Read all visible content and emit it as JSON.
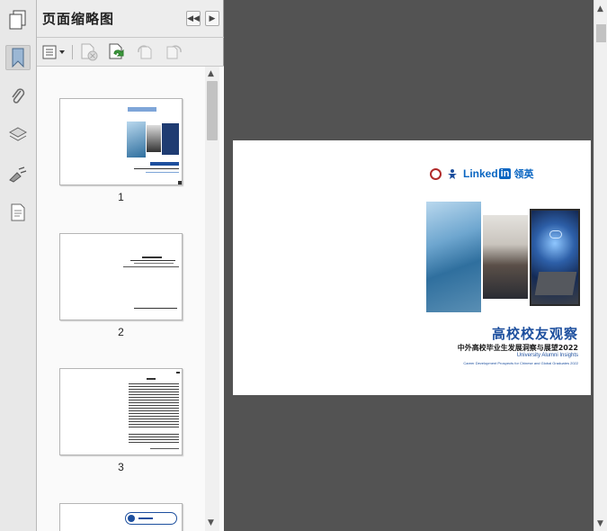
{
  "panel": {
    "title": "页面缩略图"
  },
  "thumbnails": [
    {
      "page": "1"
    },
    {
      "page": "2"
    },
    {
      "page": "3"
    },
    {
      "page": ""
    }
  ],
  "cover": {
    "brand_linkedin": "Linked",
    "brand_in": "in",
    "brand_cn": "领英",
    "title": "高校校友观察",
    "subtitle": "中外高校毕业生发展洞察与展望2022",
    "en_title": "University Alumni Insights",
    "en_subtitle": "Career Development Prospects for Chinese and Global Graduates 2022"
  },
  "icons": {
    "rail": [
      "bookmarks-icon",
      "paperclip-icon",
      "layers-icon",
      "signature-icon",
      "page-icon"
    ],
    "toolbar": [
      "thumbnail-options-icon",
      "delete-pages-icon",
      "insert-pages-icon",
      "rotate-left-icon",
      "rotate-right-icon"
    ]
  },
  "colors": {
    "accent_blue": "#1d4f9e",
    "linkedin_blue": "#0a66c2",
    "doc_background": "#535353"
  }
}
